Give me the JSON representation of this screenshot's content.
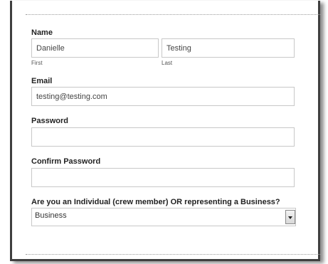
{
  "form": {
    "name": {
      "label": "Name",
      "first_value": "Danielle",
      "first_sublabel": "First",
      "last_value": "Testing",
      "last_sublabel": "Last"
    },
    "email": {
      "label": "Email",
      "value": "testing@testing.com"
    },
    "password": {
      "label": "Password",
      "value": ""
    },
    "confirm_password": {
      "label": "Confirm Password",
      "value": ""
    },
    "account_type": {
      "label": "Are you an Individual (crew member) OR representing a Business?",
      "selected": "Business"
    }
  },
  "icons": {
    "dropdown": "chevron-down-icon"
  }
}
